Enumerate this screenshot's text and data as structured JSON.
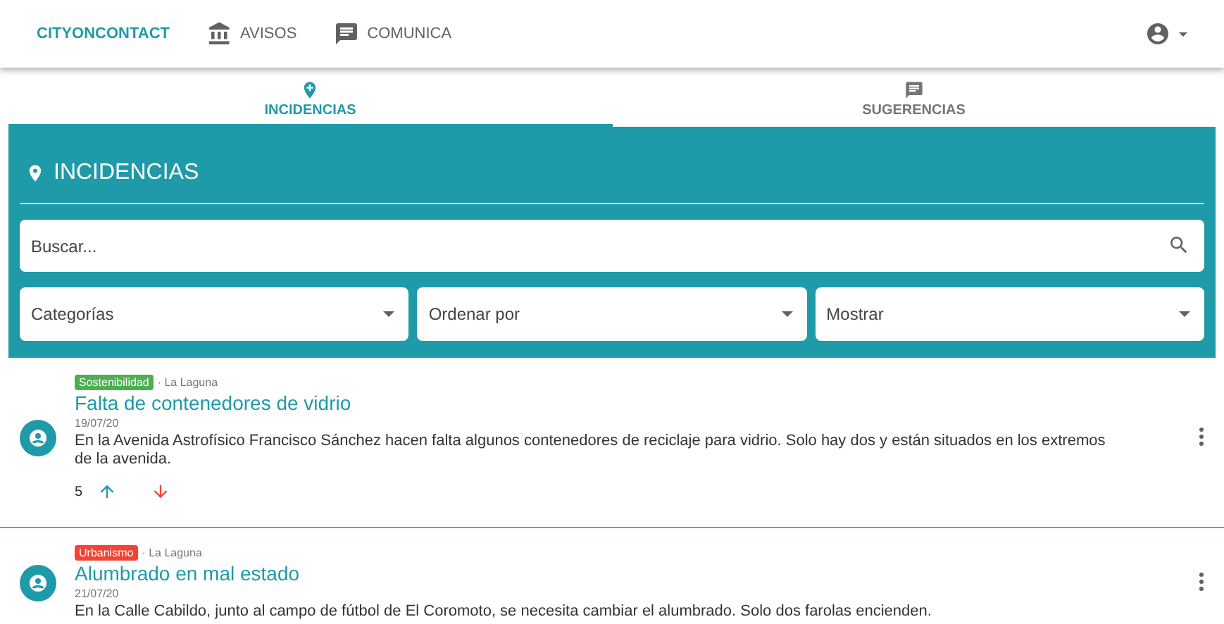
{
  "navbar": {
    "brand": "CITYONCONTACT",
    "links": [
      {
        "label": "AVISOS"
      },
      {
        "label": "COMUNICA"
      }
    ]
  },
  "tabs": [
    {
      "label": "INCIDENCIAS",
      "selected": true
    },
    {
      "label": "SUGERENCIAS",
      "selected": false
    }
  ],
  "panel": {
    "title": "INCIDENCIAS",
    "search": {
      "placeholder": "Buscar..."
    },
    "selects": [
      {
        "placeholder": "Categorías"
      },
      {
        "placeholder": "Ordenar por"
      },
      {
        "placeholder": "Mostrar"
      }
    ]
  },
  "items": [
    {
      "tag": "Sostenibilidad",
      "color": "#4caf50",
      "location": "· La Laguna",
      "title": "Falta de contenedores de vidrio",
      "date": "19/07/20",
      "description": "En la Avenida Astrofísico Francisco Sánchez hacen falta algunos contenedores de reciclaje para vidrio. Solo hay dos y están situados en los extremos de la avenida.",
      "votes": "5"
    },
    {
      "tag": "Urbanismo",
      "color": "#f44336",
      "location": "· La Laguna",
      "title": "Alumbrado en mal estado",
      "date": "21/07/20",
      "description": "En la Calle Cabildo, junto al campo de fútbol de El Coromoto, se necesita cambiar el alumbrado. Solo dos farolas encienden."
    }
  ]
}
